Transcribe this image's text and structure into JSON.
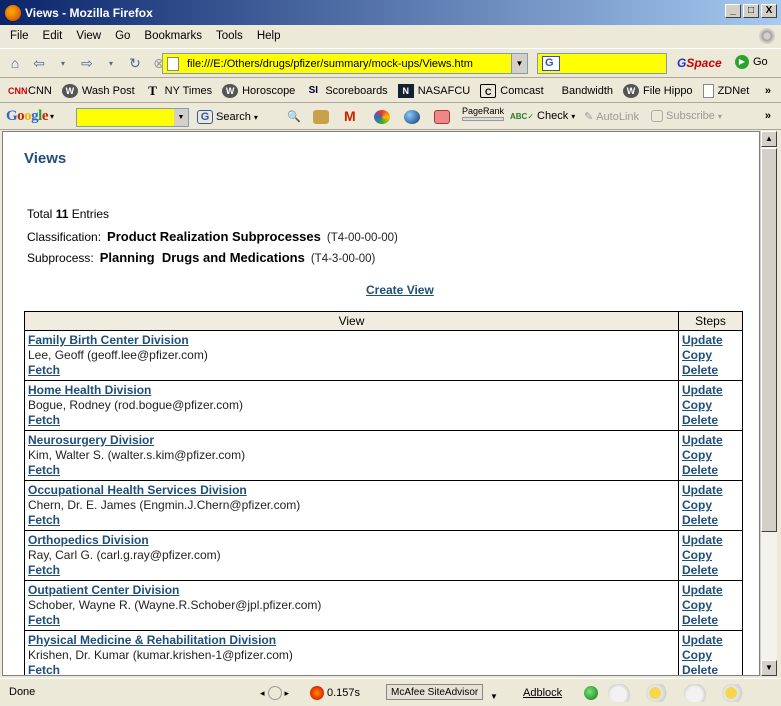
{
  "window": {
    "title": "Views - Mozilla Firefox",
    "buttons": {
      "minimize": "_",
      "maximize": "□",
      "close": "X"
    }
  },
  "menu": [
    "File",
    "Edit",
    "View",
    "Go",
    "Bookmarks",
    "Tools",
    "Help"
  ],
  "navbar": {
    "url": "file:///E:/Others/drugs/pfizer/summary/mock-ups/Views.htm",
    "gspace_g": "G",
    "gspace_rest": "Space",
    "go_label": "Go"
  },
  "bookmarks": [
    {
      "label": "CNN",
      "icon": "cnn-icon"
    },
    {
      "label": "Wash Post",
      "icon": "wp-icon"
    },
    {
      "label": "NY Times",
      "icon": "nyt-icon"
    },
    {
      "label": "Horoscope",
      "icon": "wp-icon"
    },
    {
      "label": "Scoreboards",
      "icon": "si-icon"
    },
    {
      "label": "NASAFCU",
      "icon": "n-icon"
    },
    {
      "label": "Comcast",
      "icon": "c-icon"
    },
    {
      "label": "Bandwidth",
      "icon": ""
    },
    {
      "label": "File Hippo",
      "icon": "wp-icon"
    },
    {
      "label": "ZDNet",
      "icon": "page-icon"
    }
  ],
  "google_toolbar": {
    "logo": "Google",
    "search_label": "Search",
    "pagerank_label": "PageRank",
    "check_label": "Check",
    "autolink_label": "AutoLink",
    "subscribe_label": "Subscribe"
  },
  "page": {
    "title": "Views",
    "total_prefix": "Total ",
    "total_count": "11",
    "total_suffix": " Entries",
    "classification_label": "Classification:",
    "classification_value": "Product Realization Subprocesses",
    "classification_code": "(T4-00-00-00)",
    "subprocess_label": "Subprocess:",
    "subprocess_value": "Planning  Drugs and Medications",
    "subprocess_code": "(T4-3-00-00)",
    "create_view": "Create View",
    "table_headers": {
      "view": "View",
      "steps": "Steps"
    },
    "step_links": {
      "update": "Update",
      "copy": "Copy",
      "delete": "Delete"
    },
    "fetch_label": "Fetch",
    "rows": [
      {
        "division": "Family Birth Center Division",
        "person": "Lee, Geoff (geoff.lee@pfizer.com)"
      },
      {
        "division": "Home Health Division",
        "person": "Bogue, Rodney (rod.bogue@pfizer.com)"
      },
      {
        "division": "Neurosurgery Divisior",
        "person": "Kim, Walter S. (walter.s.kim@pfizer.com)"
      },
      {
        "division": "Occupational Health Services Division",
        "person": "Chern, Dr. E. James (Engmin.J.Chern@pfizer.com)"
      },
      {
        "division": "Orthopedics Division",
        "person": "Ray, Carl G. (carl.g.ray@pfizer.com)"
      },
      {
        "division": "Outpatient Center Division",
        "person": "Schober, Wayne R. (Wayne.R.Schober@jpl.pfizer.com)"
      },
      {
        "division": "Physical Medicine & Rehabilitation Division",
        "person": "Krishen, Dr. Kumar (kumar.krishen-1@pfizer.com)"
      }
    ]
  },
  "statusbar": {
    "done": "Done",
    "timer": "0.157s",
    "mcafee": "McAfee SiteAdvisor",
    "adblock": "Adblock"
  }
}
